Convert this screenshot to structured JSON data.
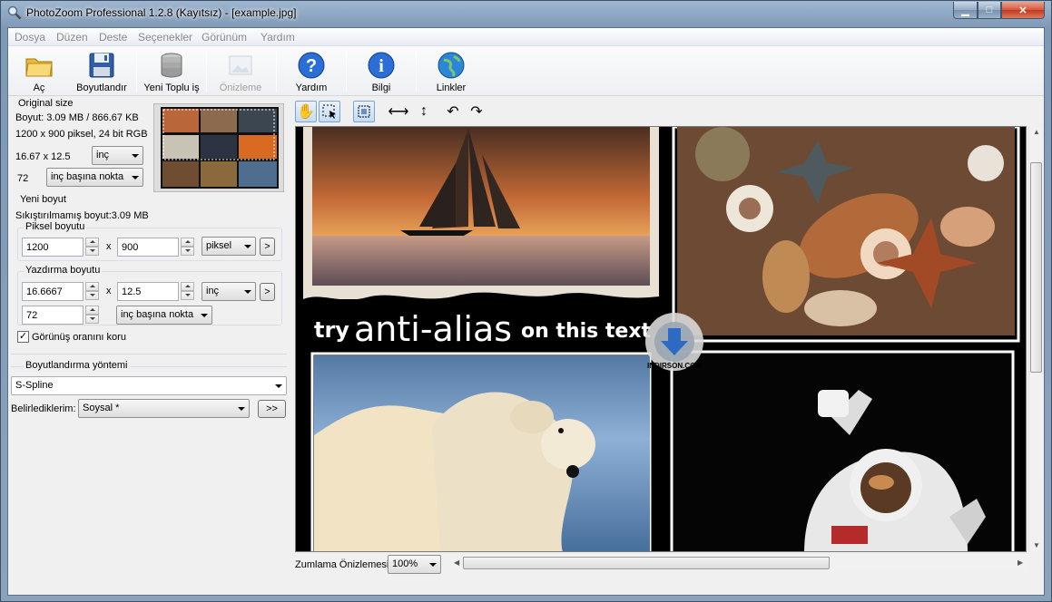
{
  "window": {
    "title": "PhotoZoom Professional 1.2.8 (Kayıtsız) - [example.jpg]",
    "minimize_glyph": "▁",
    "maximize_glyph": "□",
    "close_glyph": "✕"
  },
  "menu": [
    "Dosya",
    "Düzen",
    "Deste",
    "Seçenekler",
    "Görünüm",
    "Yardım"
  ],
  "toolbar": {
    "open": "Aç",
    "resize": "Boyutlandır",
    "new_batch": "Yeni Toplu iş",
    "preview": "Önizleme",
    "help": "Yardım",
    "info": "Bilgi",
    "links": "Linkler"
  },
  "original": {
    "group_label": "Original size",
    "size_line": "Boyut: 3.09 MB / 866.67 KB",
    "pixels_line": "1200 x 900 piksel, 24 bit RGB",
    "print_size": "16.67 x 12.5",
    "print_unit": "inç",
    "resolution": "72",
    "resolution_unit": "inç başına nokta"
  },
  "new_size": {
    "group_label": "Yeni boyut",
    "uncompressed": "Sıkıştırılmamış boyut:3.09 MB",
    "pixel_group_label": "Piksel boyutu",
    "width_px": "1200",
    "height_px": "900",
    "x_sep": "x",
    "pixel_unit": "piksel",
    "more": ">",
    "print_group_label": "Yazdırma boyutu",
    "width_print": "16.6667",
    "height_print": "12.5",
    "print_unit": "inç",
    "resolution": "72",
    "resolution_unit": "inç başına nokta",
    "keep_aspect": "Görünüş oranını koru"
  },
  "method": {
    "group_label": "Boyutlandırma yöntemi",
    "method": "S-Spline",
    "preset_label": "Belirlediklerim:",
    "preset": "Soysal *",
    "more": ">>"
  },
  "zoom": {
    "label": "Zumlama Önizlemesi:",
    "value": "100%"
  },
  "image": {
    "caption_try": "try",
    "caption_anti": "anti-alias",
    "caption_rest": "on this text",
    "watermark": "INDIRSON.COM"
  },
  "colors": {
    "accent": "#3b78c4",
    "viewport_bg": "#000000"
  }
}
